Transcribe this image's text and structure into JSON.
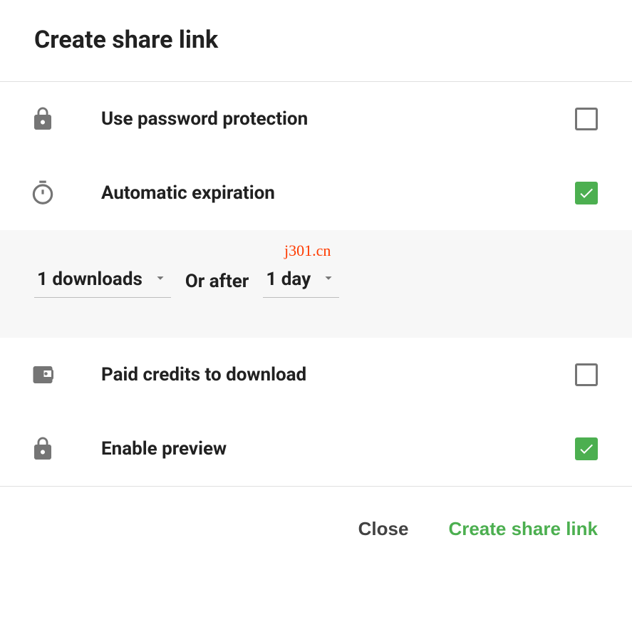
{
  "dialog": {
    "title": "Create share link"
  },
  "options": {
    "password": {
      "label": "Use password protection",
      "checked": false
    },
    "expiration": {
      "label": "Automatic expiration",
      "checked": true
    },
    "paid": {
      "label": "Paid credits to download",
      "checked": false
    },
    "preview": {
      "label": "Enable preview",
      "checked": true
    }
  },
  "expiration_panel": {
    "downloads_value": "1 downloads",
    "or_after_label": "Or after",
    "days_value": "1 day"
  },
  "watermark": "j301.cn",
  "footer": {
    "close_label": "Close",
    "create_label": "Create share link"
  },
  "colors": {
    "accent": "#4caf50",
    "icon": "#757575"
  }
}
